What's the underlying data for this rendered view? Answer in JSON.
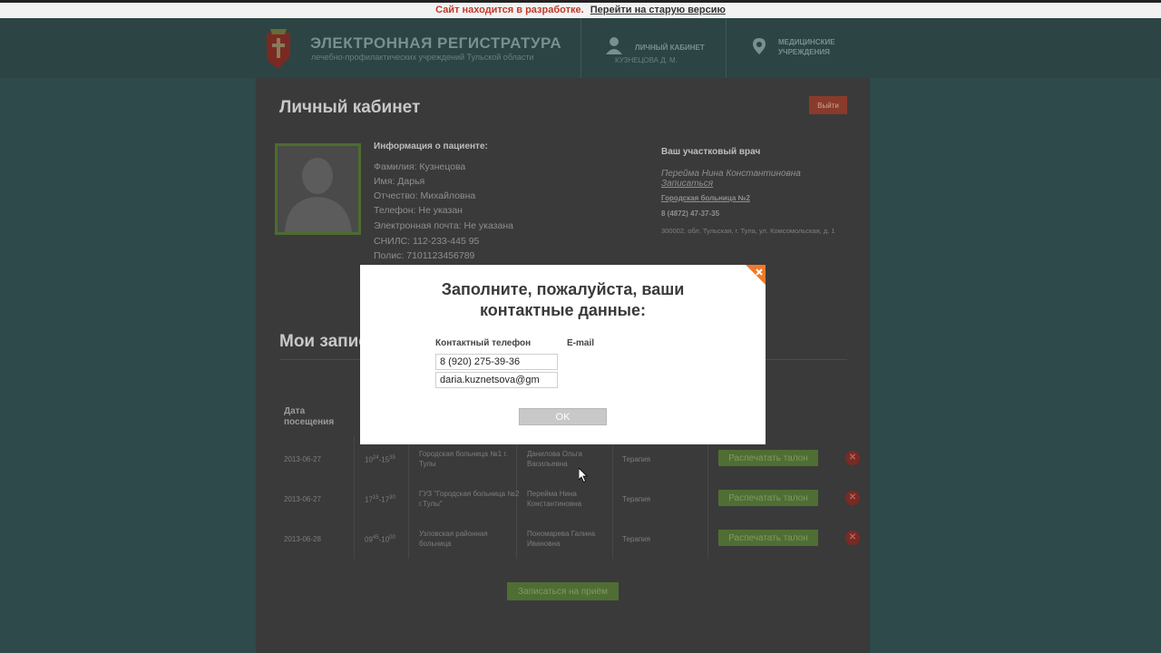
{
  "devbar": {
    "warning": "Сайт находится в разработке.",
    "link": "Перейти на старую версию"
  },
  "header": {
    "title": "ЭЛЕКТРОННАЯ РЕГИСТРАТУРА",
    "subtitle": "лечебно-профилактических учреждений Тульской области",
    "cabinet_label": "ЛИЧНЫЙ КАБИНЕТ",
    "cabinet_user": "КУЗНЕЦОВА Д. М.",
    "institutions_label": "МЕДИЦИНСКИЕ УЧРЕЖДЕНИЯ"
  },
  "page": {
    "title": "Личный кабинет",
    "logout": "Выйти"
  },
  "patient": {
    "heading": "Информация о пациенте:",
    "lines": [
      "Фамилия: Кузнецова",
      "Имя: Дарья",
      "Отчество: Михайловна",
      "Телефон: Не указан",
      "Электронная почта: Не указана",
      "СНИЛС: 112-233-445 95",
      "Полис: 7101123456789"
    ]
  },
  "doctor": {
    "heading": "Ваш участковый врач",
    "name": "Перейма Нина Константиновна",
    "signup_link": "Записаться",
    "hospital": "Городская больница №2",
    "phone": "8 (4872) 47-37-35",
    "address": "300002, обл. Тульская, г. Тула, ул. Комсомольская, д. 1"
  },
  "records": {
    "title": "Мои записи",
    "col_date": "Дата посещения",
    "print_label": "Распечатать талон",
    "cancel_glyph": "✕",
    "signup_button": "Записаться на приём",
    "rows": [
      {
        "date": "2013-06-27",
        "time": "10",
        "time_sup": "24",
        "time_dash": "-15",
        "time_sup2": "35",
        "clinic": "Городская больница №1 г. Тулы",
        "doctor": "Данилова Ольга Васильевна",
        "spec": "Терапия"
      },
      {
        "date": "2013-06-27",
        "time": "17",
        "time_sup": "15",
        "time_dash": "-17",
        "time_sup2": "30",
        "clinic": "ГУЗ \"Городская больница №2 г.Тулы\"",
        "doctor": "Перейма Нина Константиновна",
        "spec": "Терапия"
      },
      {
        "date": "2013-06-28",
        "time": "09",
        "time_sup": "45",
        "time_dash": "-10",
        "time_sup2": "00",
        "clinic": "Узловская районная больница",
        "doctor": "Пономарева Галина Ивановна",
        "spec": "Терапия"
      }
    ]
  },
  "modal": {
    "title_line1": "Заполните, пожалуйста, ваши",
    "title_line2": "контактные данные:",
    "phone_label": "Контактный телефон",
    "email_label": "E-mail",
    "phone_value": "8 (920) 275-39-36",
    "email_value": "daria.kuznetsova@gm",
    "ok": "OK",
    "close_glyph": "×"
  },
  "colors": {
    "accent_orange": "#f07a2a",
    "dev_warning": "#c0392b",
    "overlay_bg": "#2f4a4a"
  }
}
